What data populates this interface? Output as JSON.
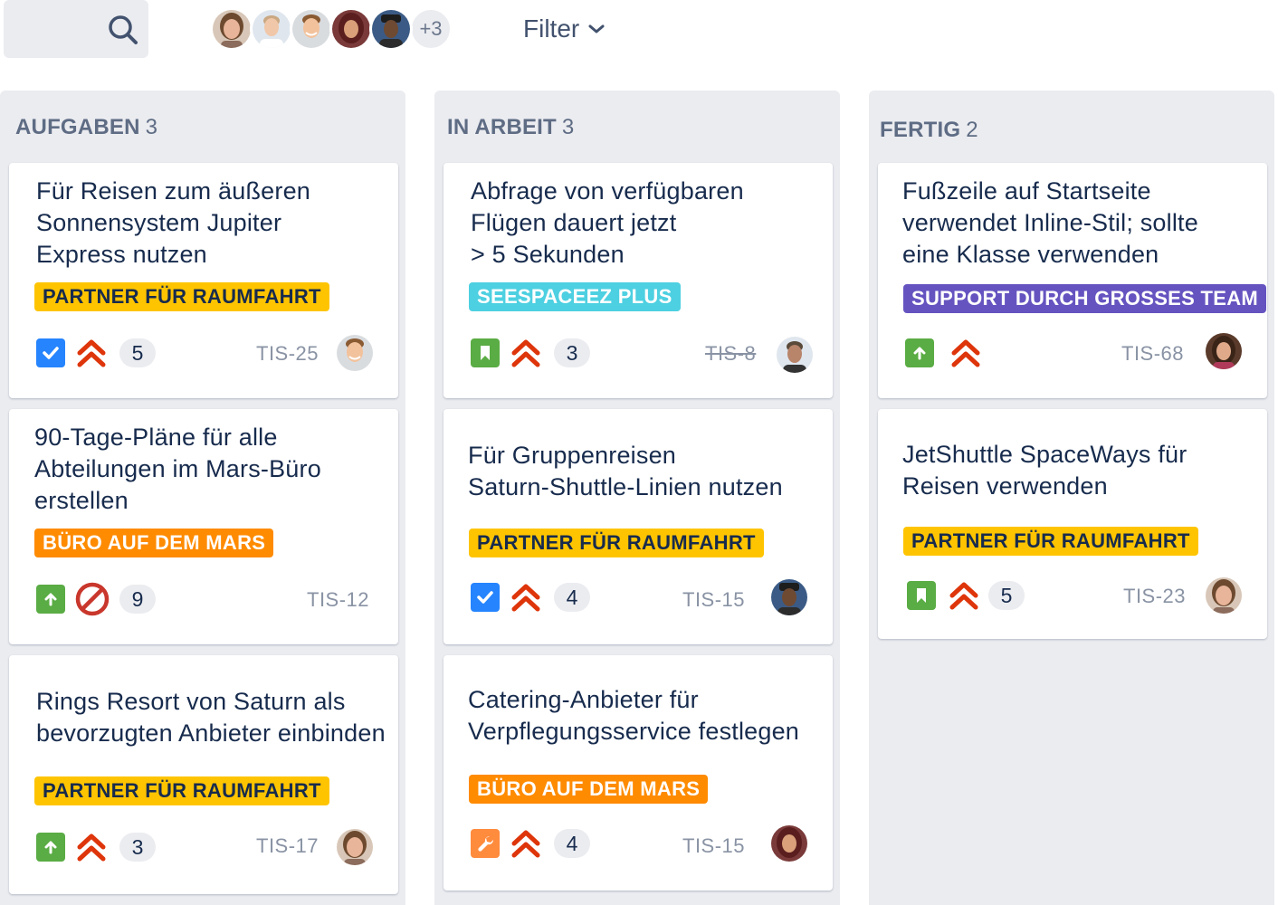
{
  "toolbar": {
    "search_icon": "search-icon",
    "avatars": [
      {
        "name": "avatar-1",
        "skin": "#e8b59a",
        "hair": "#6d4a2f",
        "bg": "#d8c7b8"
      },
      {
        "name": "avatar-2",
        "skin": "#f0c7a8",
        "hair": "#c9a882",
        "bg": "#dfe6ee"
      },
      {
        "name": "avatar-3",
        "skin": "#f2c29c",
        "hair": "#8a5a33",
        "bg": "#d9dcdf"
      },
      {
        "name": "avatar-4",
        "skin": "#d9a07a",
        "hair": "#5a1e1e",
        "bg": "#7a3a3a"
      },
      {
        "name": "avatar-5",
        "skin": "#6e4a32",
        "hair": "#1d1d1d",
        "bg": "#3b5b86"
      }
    ],
    "more_label": "+3",
    "filter_label": "Filter"
  },
  "columns": [
    {
      "title": "AUFGABEN",
      "count": "3",
      "cards": [
        {
          "title_lines": [
            "Für Reisen zum äußeren",
            "Sonnensystem Jupiter",
            "Express nutzen"
          ],
          "label": "PARTNER FÜR RAUMFAHRT",
          "label_color": "yellow",
          "type": "task",
          "type_icon": "check-icon",
          "priority": "highest",
          "blocked": false,
          "estimate": "5",
          "key": "TIS-25",
          "key_done": false,
          "assignee": true
        },
        {
          "title_lines": [
            "90-Tage-Pläne für alle",
            "Abteilungen im Mars-Büro",
            "erstellen"
          ],
          "label": "BÜRO AUF DEM MARS",
          "label_color": "orange",
          "type": "improve",
          "type_icon": "arrow-up-icon",
          "priority": "none",
          "blocked": true,
          "estimate": "9",
          "key": "TIS-12",
          "key_done": false,
          "assignee": false
        },
        {
          "title_lines": [
            "Rings Resort von Saturn als",
            "bevorzugten Anbieter einbinden"
          ],
          "label": "PARTNER FÜR RAUMFAHRT",
          "label_color": "yellow",
          "type": "improve",
          "type_icon": "arrow-up-icon",
          "priority": "highest",
          "blocked": false,
          "estimate": "3",
          "key": "TIS-17",
          "key_done": false,
          "assignee": true
        }
      ]
    },
    {
      "title": "IN ARBEIT",
      "count": "3",
      "cards": [
        {
          "title_lines": [
            "Abfrage von verfügbaren",
            "Flügen dauert jetzt",
            "> 5 Sekunden"
          ],
          "label": "SEESPACEEZ PLUS",
          "label_color": "teal",
          "type": "story",
          "type_icon": "bookmark-icon",
          "priority": "highest",
          "blocked": false,
          "estimate": "3",
          "key": "TIS-8",
          "key_done": true,
          "assignee": true
        },
        {
          "title_lines": [
            "Für Gruppenreisen",
            "Saturn-Shuttle-Linien nutzen"
          ],
          "label": "PARTNER FÜR RAUMFAHRT",
          "label_color": "yellow",
          "type": "task",
          "type_icon": "check-icon",
          "priority": "highest",
          "blocked": false,
          "estimate": "4",
          "key": "TIS-15",
          "key_done": false,
          "assignee": true
        },
        {
          "title_lines": [
            "Catering-Anbieter für",
            "Verpflegungsservice festlegen"
          ],
          "label": "BÜRO AUF DEM MARS",
          "label_color": "orange",
          "type": "bug",
          "type_icon": "wrench-icon",
          "priority": "highest",
          "blocked": false,
          "estimate": "4",
          "key": "TIS-15",
          "key_done": false,
          "assignee": true
        }
      ]
    },
    {
      "title": "FERTIG",
      "count": "2",
      "cards": [
        {
          "title_lines": [
            "Fußzeile auf Startseite",
            "verwendet Inline-Stil; sollte",
            "eine Klasse verwenden"
          ],
          "label": "SUPPORT DURCH GROSSES TEAM",
          "label_color": "purple",
          "type": "improve",
          "type_icon": "arrow-up-icon",
          "priority": "highest",
          "blocked": false,
          "estimate": "",
          "key": "TIS-68",
          "key_done": false,
          "assignee": true
        },
        {
          "title_lines": [
            "JetShuttle SpaceWays für",
            "Reisen verwenden"
          ],
          "label": "PARTNER FÜR RAUMFAHRT",
          "label_color": "yellow",
          "type": "story",
          "type_icon": "bookmark-icon",
          "priority": "highest",
          "blocked": false,
          "estimate": "5",
          "key": "TIS-23",
          "key_done": false,
          "assignee": true
        }
      ]
    }
  ],
  "colors": {
    "background": "#ffffff",
    "column": "#ebecf0",
    "priority_red": "#de350b",
    "blocked_red": "#c9372c",
    "task_blue": "#2684ff",
    "story_green": "#5aac44",
    "bug_orange": "#ff8b3d"
  }
}
